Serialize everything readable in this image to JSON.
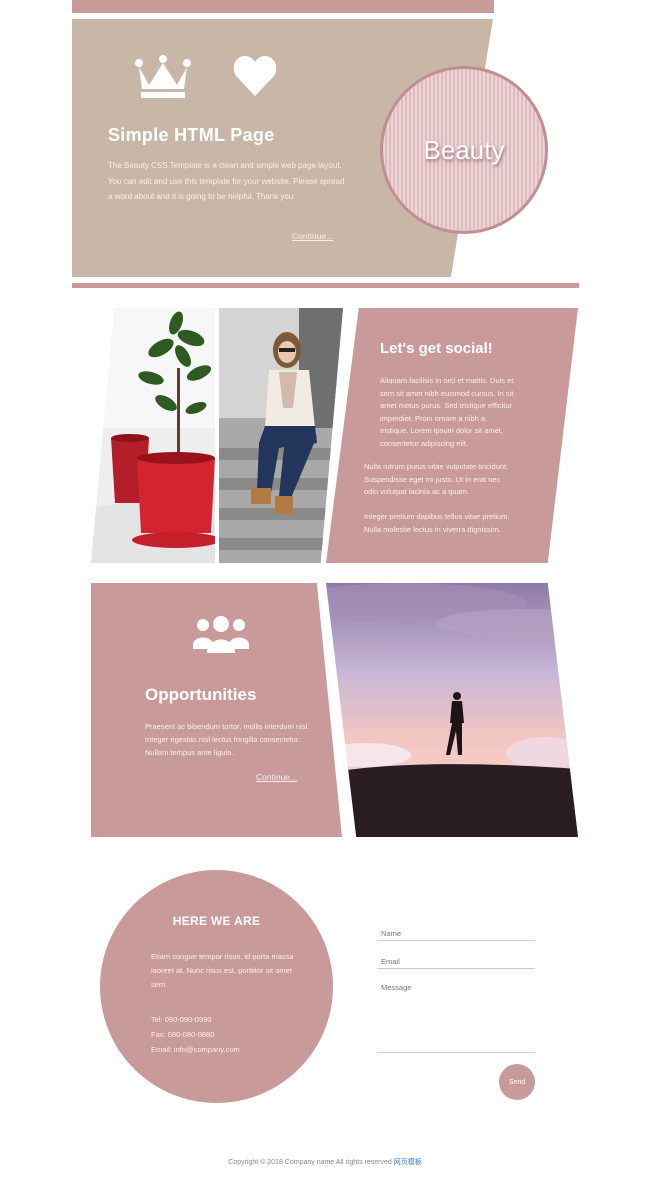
{
  "hero": {
    "title": "Simple HTML Page",
    "text": "The Beauty CSS Template is a clean and simple web page layout. You can edit and use this template for your website. Please spread a word about and it is going to be helpful. Thank you.",
    "link": "Continue...",
    "badge": "Beauty",
    "icons": [
      "crown-icon",
      "heart-icon"
    ]
  },
  "social": {
    "title": "Let's get social!",
    "paragraphs": [
      "Aliquam facilisis in orci et mattis. Duis et sem sit amet nibh euismod cursus. In sit amet metus purus. Sed tristique efficitur imperdiet. Proin ornare a nibh a tristique. Lorem ipsum dolor sit amet, consectetur adipiscing elit.",
      "Nulla rutrum purus vitae vulputate tincidunt. Suspendisse eget mi justo. Ut in erat nec odio volutpat lacinia ac a quam.",
      "Integer pretium dapibus tellus vitae pretium. Nulla molestie lectus in viverra dignissim."
    ]
  },
  "opportunities": {
    "title": "Opportunities",
    "text": "Praesent ac bibendum tortor, mollis interdum nisl. Integer egestas nisl lectus fringilla consectetur. Nullam tempus ante ligula.",
    "link": "Continue...",
    "icon": "users-icon"
  },
  "contact": {
    "title": "HERE WE ARE",
    "address": "Etiam congue tempor risus, id porta massa laoreet at. Nunc risus est, porttitor sit amet sem.",
    "tel": "Tel: 090-090-0990",
    "fax": "Fax: 080-080-0880",
    "email": "Email: info@company.com"
  },
  "form": {
    "name_placeholder": "Name",
    "email_placeholder": "Email",
    "message_placeholder": "Message",
    "send_label": "Send"
  },
  "footer": {
    "copyright": "Copyright © 2018 Company name All rights reserved",
    "link": "网页模板"
  },
  "colors": {
    "accent": "#c99a9a",
    "hero_bg": "#c8b7a6",
    "circle_stripe": "#ecd3d6"
  }
}
